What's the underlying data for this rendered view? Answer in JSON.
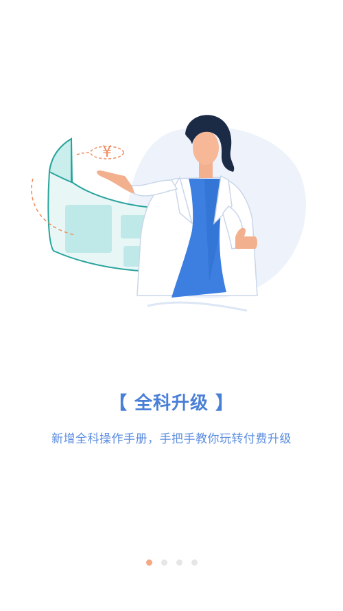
{
  "onboarding": {
    "title": "【 全科升级 】",
    "subtitle": "新增全科操作手册，手把手教你玩转付费升级",
    "illustration_coin_symbol": "¥",
    "page_indicator": {
      "total": 4,
      "active_index": 0
    }
  },
  "colors": {
    "accent": "#4a7fd6",
    "dot_active": "#f5a884",
    "dot_inactive": "#e6e6e6"
  }
}
